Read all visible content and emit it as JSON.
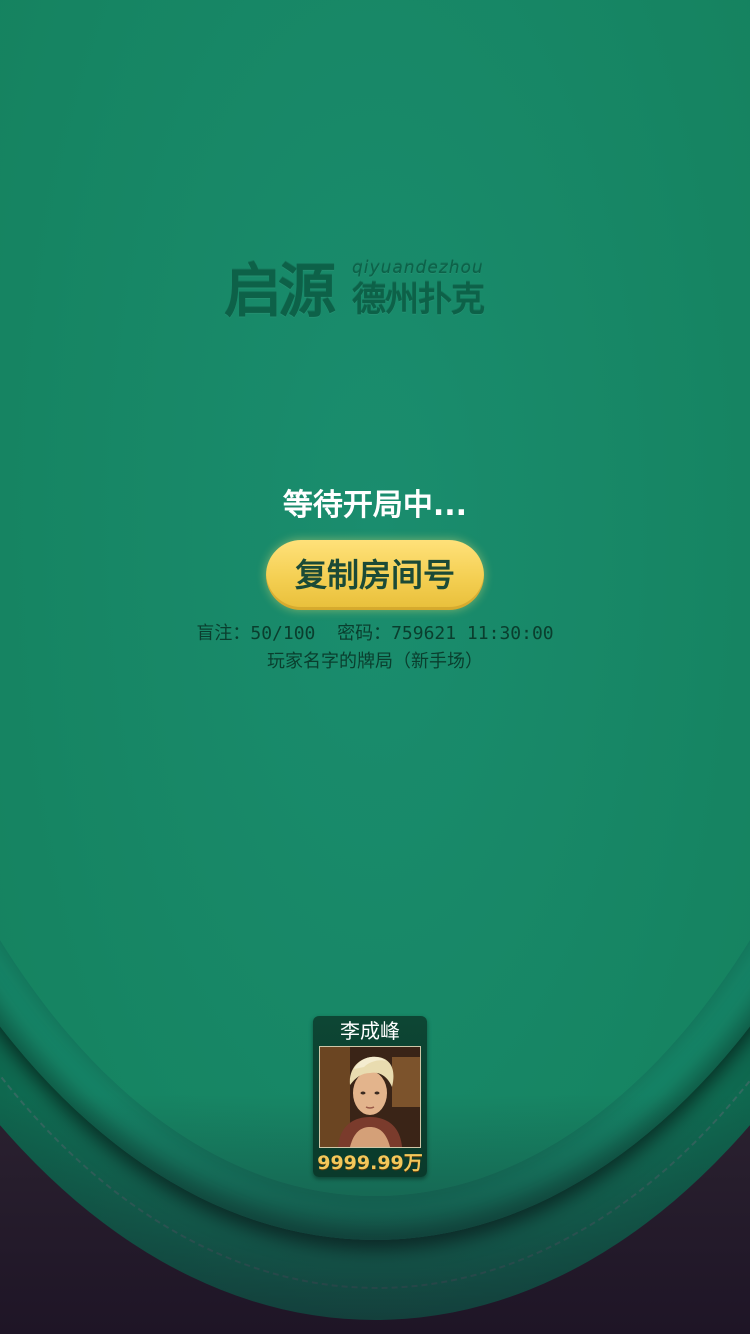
{
  "logo": {
    "main": "启源",
    "pinyin": "qiyuandezhou",
    "sub": "德州扑克"
  },
  "status": {
    "waiting_text": "等待开局中..."
  },
  "actions": {
    "copy_room_label": "复制房间号"
  },
  "room_info": {
    "line1": "盲注：50/100  密码：759621 11:30:00",
    "line2": "玩家名字的牌局（新手场）"
  },
  "player": {
    "name": "李成峰",
    "chips": "9999.99万"
  },
  "colors": {
    "felt": "#168567",
    "button": "#f4cf52",
    "chips_text": "#f3c75a"
  }
}
